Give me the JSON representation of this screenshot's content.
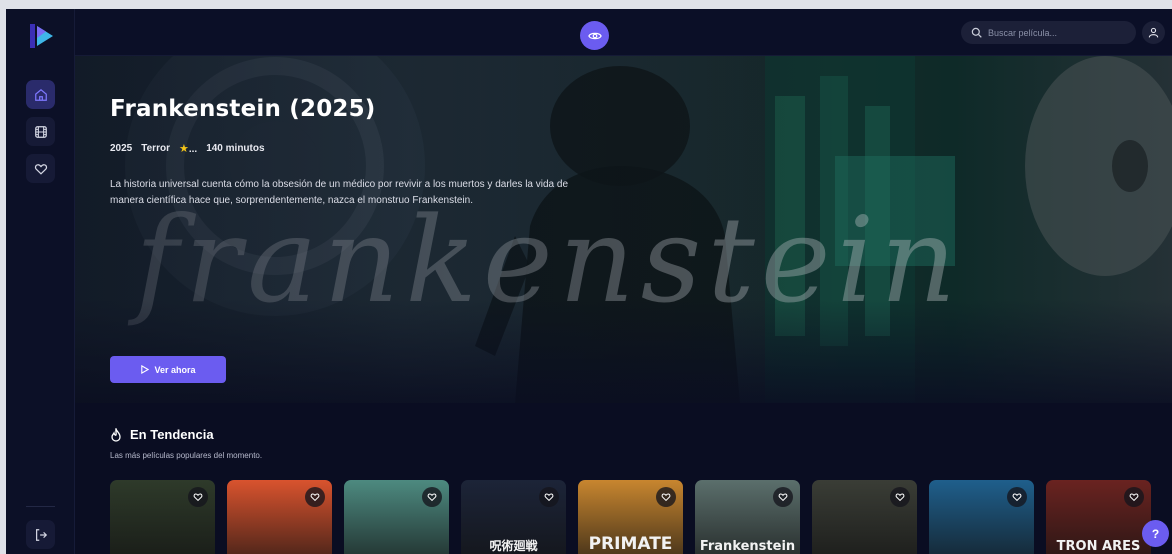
{
  "app": {
    "brand_color": "#6b5cf0",
    "logo_icon": "play-logo-icon"
  },
  "sidebar": {
    "items": [
      {
        "name": "home",
        "icon": "home-icon",
        "active": true
      },
      {
        "name": "movies",
        "icon": "film-icon",
        "active": false
      },
      {
        "name": "favorites",
        "icon": "heart-icon",
        "active": false
      }
    ],
    "logout_icon": "logout-icon"
  },
  "topbar": {
    "center_icon": "eye-icon",
    "search_placeholder": "Buscar película...",
    "user_icon": "user-icon"
  },
  "hero": {
    "title": "Frankenstein (2025)",
    "year": "2025",
    "genre": "Terror",
    "rating": "...",
    "duration": "140 minutos",
    "description": "La historia universal cuenta cómo la obsesión de un médico por revivir a los muertos y darles la vida de manera científica hace que, sorprendentemente, nazca el monstruo Frankenstein.",
    "cta_label": "Ver ahora",
    "backdrop_text": "frankenstein"
  },
  "trending": {
    "title": "En Tendencia",
    "subtitle": "Las más películas populares del momento.",
    "cards": [
      {
        "text": "",
        "bg": "#2e3a2a"
      },
      {
        "text": "",
        "bg": "#d9532e"
      },
      {
        "text": "",
        "bg": "#4d8a80"
      },
      {
        "text": "呪術廻戦",
        "bg": "#1c2438"
      },
      {
        "text": "PRIMATE",
        "bg": "#c8862f"
      },
      {
        "text": "Frankenstein",
        "bg": "#5b6f6c"
      },
      {
        "text": "",
        "bg": "#3a3d36"
      },
      {
        "text": "",
        "bg": "#1f5f8c"
      },
      {
        "text": "TRON ARES",
        "bg": "#6a2320"
      }
    ]
  },
  "help_label": "?"
}
